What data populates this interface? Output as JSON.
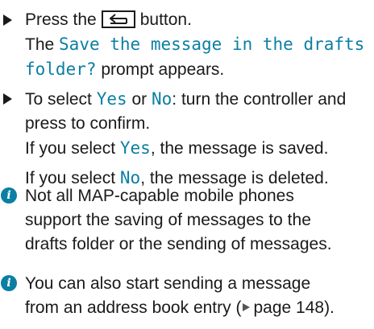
{
  "steps": [
    {
      "parts": [
        "Press the",
        "button."
      ],
      "button_icon": "back-button-icon",
      "result": {
        "line1_prefix": "The ",
        "line1_highlight": "Save the message in the drafts",
        "line2_highlight": "folder?",
        "line2_suffix": " prompt appears."
      }
    },
    {
      "line1_prefix": "To select ",
      "opt_yes": "Yes",
      "line1_mid": " or ",
      "opt_no": "No",
      "line1_suffix": ": turn the controller and",
      "line2": "press to confirm.",
      "result_yes_prefix": "If you select ",
      "result_yes_value": "Yes",
      "result_yes_suffix": ", the message is saved.",
      "result_no_prefix": "If you select ",
      "result_no_value": "No",
      "result_no_suffix": ", the message is deleted."
    }
  ],
  "notes": [
    {
      "icon": "info-icon",
      "icon_char": "i",
      "lines": [
        "Not all MAP-capable mobile phones",
        "support the saving of messages to the",
        "drafts folder or the sending of messages."
      ]
    },
    {
      "icon": "info-icon",
      "icon_char": "i",
      "line1": "You can also start sending a message",
      "line2_prefix": "from an address book entry (",
      "page_ref": "page 148",
      "line2_suffix": ")."
    }
  ],
  "colors": {
    "highlight": "#0b7fa3",
    "text": "#1a1a1a"
  }
}
